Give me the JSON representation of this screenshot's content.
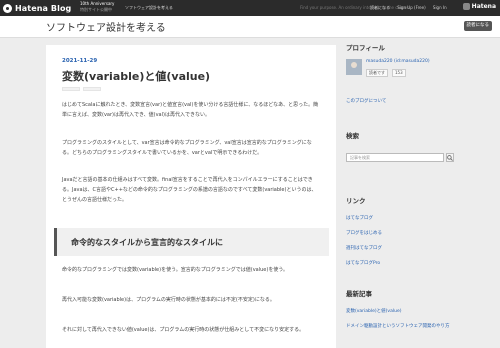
{
  "topbar": {
    "logo_text": "Hatena Blog",
    "promo_title": "10th Anniversary",
    "promo_sub": "特別サイト公開中",
    "blog_pick": "ソフトウェア設計を考える",
    "tagline": "Find your purpose. An ordinary interface to the chosen.",
    "links": [
      "読者になる",
      "Sign Up (Free)",
      "Sign In"
    ],
    "brand": "Hatena"
  },
  "header": {
    "blog_title": "ソフトウェア設計を考える",
    "reader_button": "読者になる"
  },
  "article": {
    "date": "2021-11-29",
    "title": "変数(variable)と値(value)",
    "paragraphs": [
      "はじめてScalaに触れたとき、変数宣言(var)と値宣言(val)を使い分ける言語仕様に、なるほどなあ、と思った。簡単に言えば、変数(var)は再代入でき、値(val)は再代入できない。",
      "プログラミングのスタイルとして、var宣言は命令的なプログラミング、val宣言は宣言的なプログラミングになる。どちらのプログラミングスタイルで書いているかを、varとvalで明示できるわけだ。",
      "Javaだと言語の基本の仕組みはすべて変数。final宣言をすることで再代入をコンパイルエラーにすることはできる。Javaは、C言語やC++などの命令的なプログラミングの系譜の言語なのですべて変数(variable)というのは、とうぜんの言語仕様だった。"
    ],
    "heading": "命令的なスタイルから宣言的なスタイルに",
    "paragraphs_after": [
      "命令的なプログラミングでは変数(variable)を使う。宣言的なプログラミングでは値(value)を使う。",
      "再代入可能な変数(variable)は、プログラムの実行時の状態が基本的には不定(不安定)になる。",
      "それに対して再代入できない値(value)は、プログラムの実行時の状態が仕組みとして不変になり安定する。"
    ]
  },
  "sidebar": {
    "profile_heading": "プロフィール",
    "user_name": "masuda220 (id:masuda220)",
    "readers_button": "読者です",
    "readers_count": "153",
    "about_link": "このブログについて",
    "search_heading": "検索",
    "search_placeholder": "記事を検索",
    "links_heading": "リンク",
    "links": [
      "はてなブログ",
      "ブログをはじめる",
      "週刊はてなブログ",
      "はてなブログPro"
    ],
    "recent_heading": "最新記事",
    "recent": [
      "変数(variable)と値(value)",
      "ドメイン駆動設計というソフトウェア開発のやり方"
    ]
  }
}
